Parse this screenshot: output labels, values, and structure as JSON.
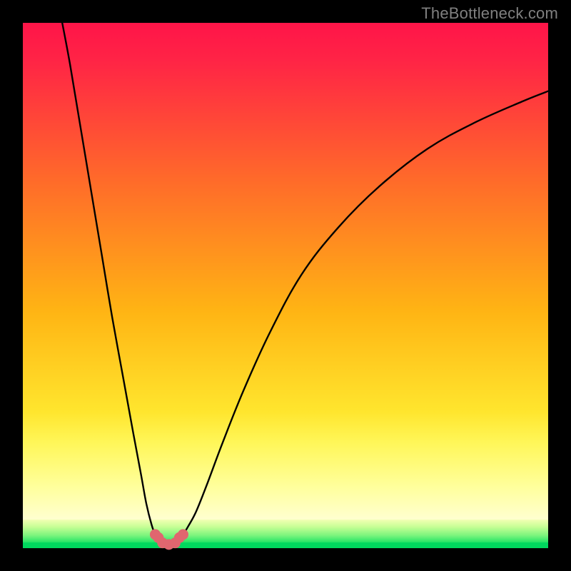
{
  "watermark": "TheBottleneck.com",
  "colors": {
    "gradient_top": "#ff1549",
    "gradient_mid": "#ffb300",
    "gradient_yellow": "#fff33a",
    "gradient_lightyellow": "#ffffa0",
    "green": "#00e060",
    "curve": "#000000",
    "marker": "#e0666f",
    "bg": "#000000"
  },
  "layout": {
    "plot_left": 32,
    "plot_top": 32,
    "plot_size": 736,
    "green_band_top_frac": 0.952,
    "yellow_band_top_frac": 0.8
  },
  "chart_data": {
    "type": "line",
    "title": "",
    "xlabel": "",
    "ylabel": "",
    "xlim": [
      0,
      100
    ],
    "ylim": [
      0,
      100
    ],
    "series": [
      {
        "name": "curve-left",
        "x": [
          7.5,
          9,
          11,
          13,
          15,
          17,
          19,
          21,
          22.5,
          23.5,
          24.5,
          25.2,
          25.8
        ],
        "y": [
          100,
          92,
          80,
          68,
          56,
          44,
          33,
          22,
          14,
          8.5,
          4.5,
          2.6,
          2.0
        ]
      },
      {
        "name": "curve-right",
        "x": [
          29.8,
          30.5,
          31.5,
          33,
          35,
          38,
          42,
          47,
          53,
          60,
          68,
          77,
          86,
          95,
          100
        ],
        "y": [
          2.0,
          2.6,
          4.2,
          7,
          12,
          20,
          30,
          41,
          52,
          61,
          69,
          76,
          81,
          85,
          87
        ]
      },
      {
        "name": "valley-floor",
        "x": [
          25.8,
          26.6,
          27.8,
          29.0,
          29.8
        ],
        "y": [
          2.0,
          1.0,
          0.7,
          1.0,
          2.0
        ]
      }
    ],
    "markers": [
      {
        "x": 25.2,
        "y": 2.6
      },
      {
        "x": 25.8,
        "y": 2.0
      },
      {
        "x": 26.6,
        "y": 1.0
      },
      {
        "x": 27.8,
        "y": 0.7
      },
      {
        "x": 29.0,
        "y": 1.0
      },
      {
        "x": 29.8,
        "y": 2.0
      },
      {
        "x": 30.5,
        "y": 2.6
      }
    ]
  }
}
